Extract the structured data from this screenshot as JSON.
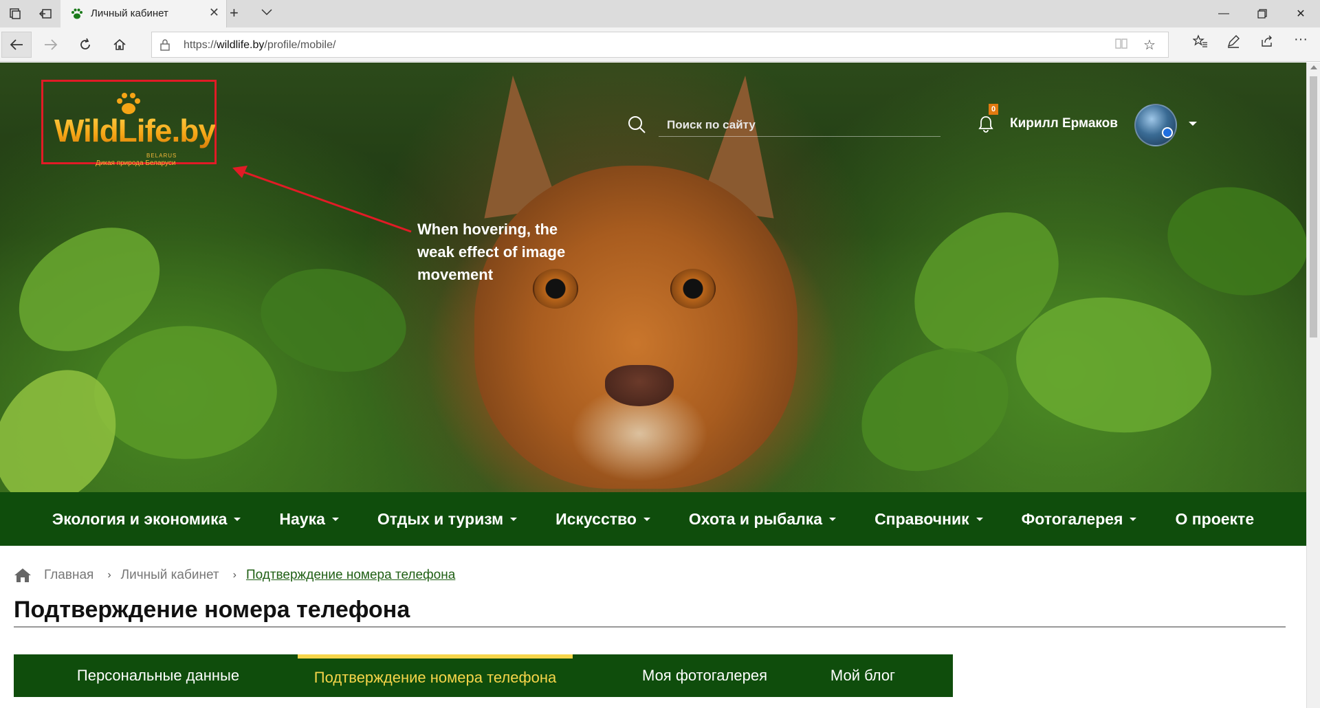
{
  "browser": {
    "tab_title": "Личный кабинет",
    "url_prefix": "https://",
    "url_domain": "wildlife.by",
    "url_path": "/profile/mobile/"
  },
  "site": {
    "logo_text": "WildLife.by",
    "logo_country": "BELARUS",
    "logo_tagline": "Дикая природа Беларуси",
    "search_placeholder": "Поиск по сайту",
    "notifications_count": "0",
    "user_name": "Кирилл Ермаков"
  },
  "annotation": {
    "text": "When hovering, the weak effect of image movement",
    "color": "#e11b26"
  },
  "main_menu": [
    {
      "label": "Экология и экономика",
      "has_dropdown": true
    },
    {
      "label": "Наука",
      "has_dropdown": true
    },
    {
      "label": "Отдых и туризм",
      "has_dropdown": true
    },
    {
      "label": "Искусство",
      "has_dropdown": true
    },
    {
      "label": "Охота и рыбалка",
      "has_dropdown": true
    },
    {
      "label": "Справочник",
      "has_dropdown": true
    },
    {
      "label": "Фотогалерея",
      "has_dropdown": true
    },
    {
      "label": "О проекте",
      "has_dropdown": false
    }
  ],
  "breadcrumb": {
    "home": "Главная",
    "cabinet": "Личный кабинет",
    "current": "Подтверждение номера телефона"
  },
  "page_title": "Подтверждение номера телефона",
  "profile_tabs": [
    {
      "label": "Персональные данные",
      "active": false
    },
    {
      "label": "Подтверждение номера телефона",
      "active": true
    },
    {
      "label": "Моя фотогалерея",
      "active": false
    },
    {
      "label": "Мой блог",
      "active": false
    }
  ],
  "colors": {
    "brand_green": "#0f4d0c",
    "accent_yellow": "#f6d54a",
    "logo_orange": "#f5a516"
  }
}
